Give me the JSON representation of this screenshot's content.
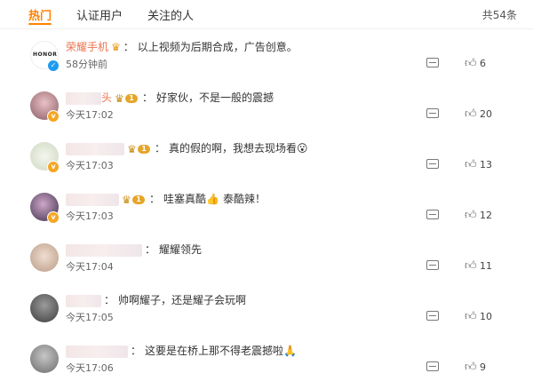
{
  "tabs": [
    {
      "label": "热门"
    },
    {
      "label": "认证用户"
    },
    {
      "label": "关注的人"
    }
  ],
  "total": "共54条",
  "comments": [
    {
      "username": "荣耀手机",
      "text": "以上视频为后期合成，广告创意。",
      "time": "58分钟前",
      "likes": "6",
      "avatar_text": "HONOR",
      "vip_level": "",
      "emoji": ""
    },
    {
      "username": "头",
      "text": "好家伙，不是一般的震撼",
      "time": "今天17:02",
      "likes": "20",
      "vip_level": "1",
      "emoji": ""
    },
    {
      "username": "",
      "text": "真的假的啊，我想去现场看",
      "time": "今天17:03",
      "likes": "13",
      "vip_level": "1",
      "emoji": "😮"
    },
    {
      "username": "",
      "text": "哇塞真酷",
      "text2": "泰酷辣！",
      "time": "今天17:03",
      "likes": "12",
      "vip_level": "1",
      "emoji": "👍"
    },
    {
      "username": "",
      "text": "耀耀领先",
      "time": "今天17:04",
      "likes": "11",
      "vip_level": "",
      "emoji": ""
    },
    {
      "username": "",
      "text": "帅啊耀子，还是耀子会玩啊",
      "time": "今天17:05",
      "likes": "10",
      "vip_level": "",
      "emoji": ""
    },
    {
      "username": "",
      "text": "这要是在桥上那不得老震撼啦",
      "time": "今天17:06",
      "likes": "9",
      "vip_level": "",
      "emoji": "🙏"
    }
  ],
  "colors": {
    "accent": "#ff8200",
    "username": "#eb7350",
    "verified": "#1e9bf0"
  }
}
